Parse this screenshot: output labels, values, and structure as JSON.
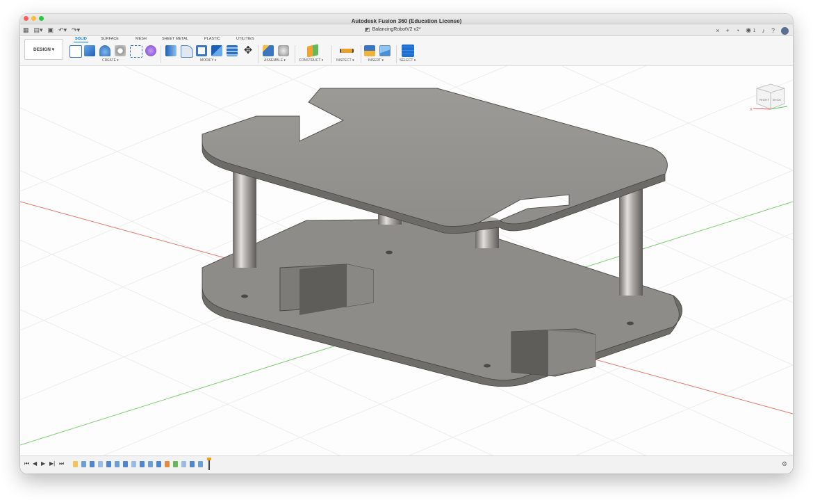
{
  "window": {
    "title": "Autodesk Fusion 360 (Education License)"
  },
  "tabbar": {
    "doc_tab_label": "BalancingRobotV2 v2*",
    "notifications_count": "1"
  },
  "workspace": {
    "label": "DESIGN ▾"
  },
  "ribbon_tabs": [
    {
      "label": "SOLID",
      "active": true
    },
    {
      "label": "SURFACE",
      "active": false
    },
    {
      "label": "MESH",
      "active": false
    },
    {
      "label": "SHEET METAL",
      "active": false
    },
    {
      "label": "PLASTIC",
      "active": false
    },
    {
      "label": "UTILITIES",
      "active": false
    }
  ],
  "ribbon_groups": [
    {
      "label": "CREATE ▾",
      "icons": [
        "sketch-icon",
        "extrude-icon",
        "revolve-icon",
        "hole-icon",
        "pattern-icon",
        "form-icon"
      ]
    },
    {
      "label": "MODIFY ▾",
      "icons": [
        "press-pull-icon",
        "fillet-icon",
        "shell-icon",
        "combine-icon",
        "scale-icon",
        "move-icon"
      ]
    },
    {
      "label": "ASSEMBLE ▾",
      "icons": [
        "new-component-icon",
        "joint-icon"
      ]
    },
    {
      "label": "CONSTRUCT ▾",
      "icons": [
        "offset-plane-icon"
      ]
    },
    {
      "label": "INSPECT ▾",
      "icons": [
        "measure-icon"
      ]
    },
    {
      "label": "INSERT ▾",
      "icons": [
        "insert-derive-icon",
        "decal-icon"
      ]
    },
    {
      "label": "SELECT ▾",
      "icons": [
        "select-icon"
      ]
    }
  ],
  "viewcube": {
    "face_right": "RIGHT",
    "face_back": "BACK",
    "axis_x": "X"
  },
  "colors": {
    "accent": "#0a7bd4",
    "model_grey": "#9d9b97",
    "axis_red": "#e05a4f",
    "axis_green": "#63c25a"
  }
}
